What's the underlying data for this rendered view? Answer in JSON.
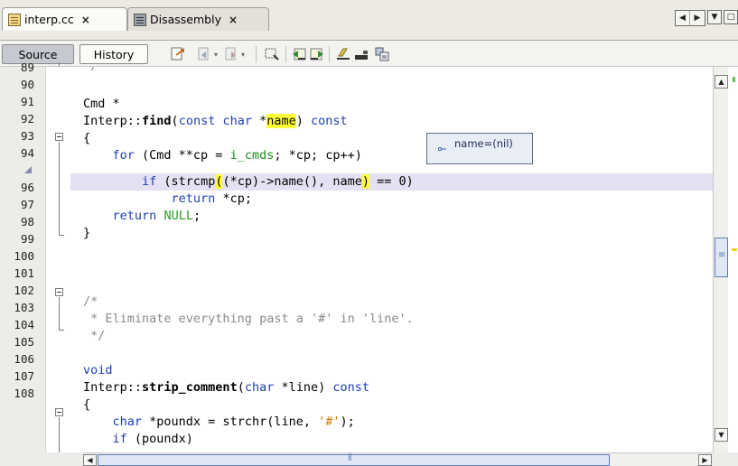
{
  "tabs": [
    {
      "label": "interp.cc",
      "icon": "cpp-file-icon",
      "active": true
    },
    {
      "label": "Disassembly",
      "icon": "disassembly-icon",
      "active": false
    }
  ],
  "close_glyph": "×",
  "toolbar": {
    "source_label": "Source",
    "history_label": "History"
  },
  "tooltip": {
    "text": "name=(nil)"
  },
  "line_numbers": [
    "90",
    "91",
    "92",
    "93",
    "94",
    "",
    "96",
    "97",
    "98",
    "99",
    "100",
    "101",
    "102",
    "103",
    "104",
    "105",
    "106",
    "107",
    "108"
  ],
  "colors": {
    "keyword": "#1c3fb0",
    "string": "#ce7b00",
    "comment": "#8a8a8a",
    "highlight_row": "#e5e1f2",
    "match_highlight": "#ffff3a",
    "null_literal": "#2a9b2a"
  }
}
